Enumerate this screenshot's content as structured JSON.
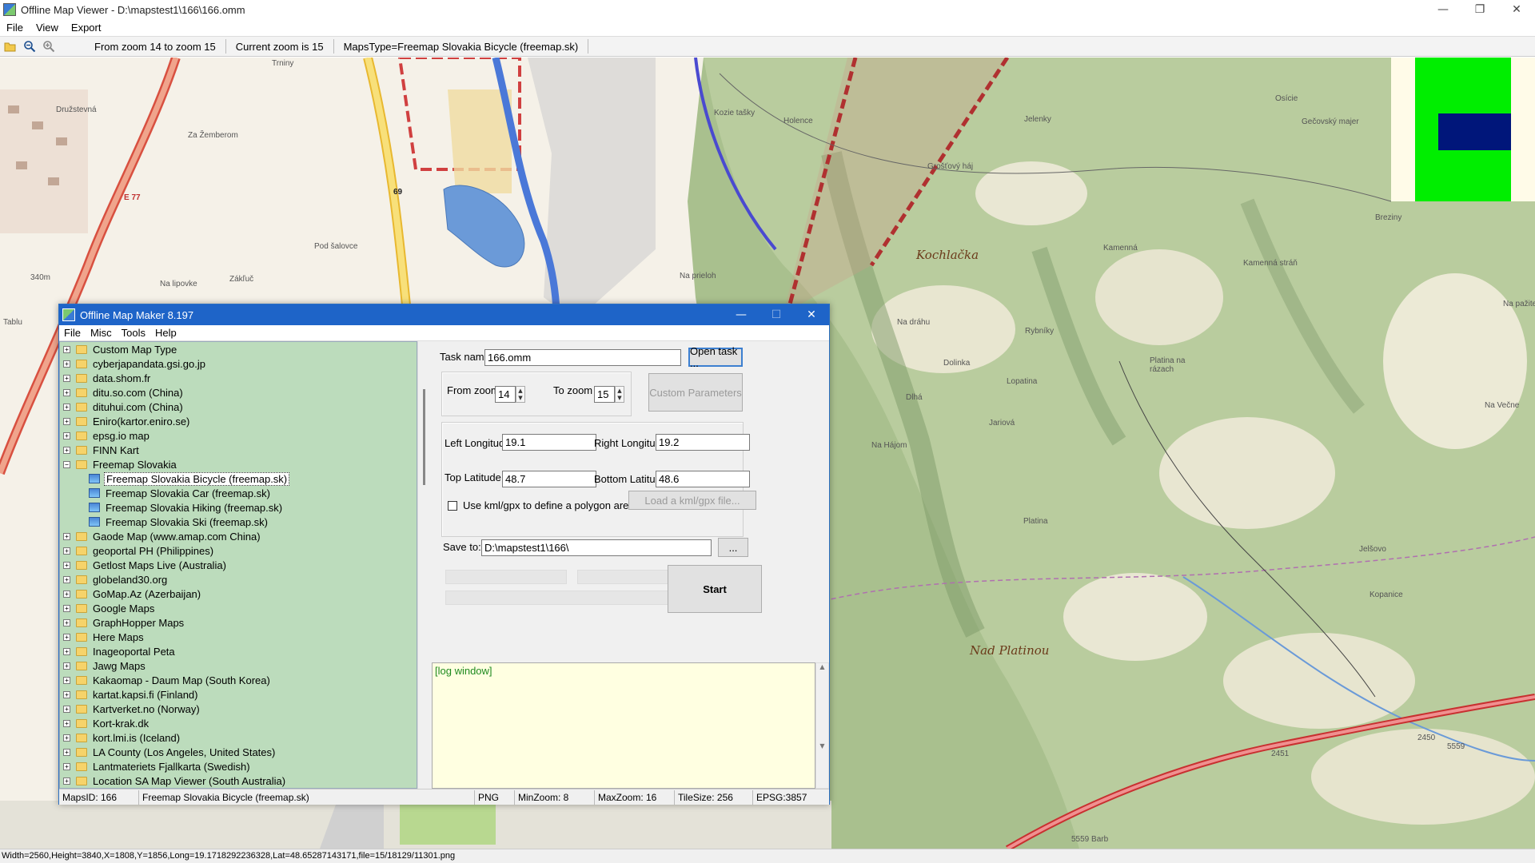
{
  "window": {
    "title": "Offline Map Viewer - D:\\mapstest1\\166\\166.omm",
    "controls": [
      "—",
      "❐",
      "✕"
    ]
  },
  "menu": [
    "File",
    "View",
    "Export"
  ],
  "toolbar": {
    "zoom_range": "From zoom 14 to zoom 15",
    "current_zoom": "Current zoom is 15",
    "maps_type": "MapsType=Freemap Slovakia Bicycle (freemap.sk)"
  },
  "map": {
    "labels": {
      "trniny": "Trniny",
      "druzstevna": "Družstevná",
      "za_zemberom": "Za Žemberom",
      "pod_salovce": "Pod šalovce",
      "na_lipovke": "Na lipovke",
      "zakluc": "Zákľuč",
      "elev_340": "340m",
      "tablu": "Tablu",
      "kozie_tasky": "Kozie tašky",
      "holence": "Holence",
      "jelenky": "Jelenky",
      "osicie": "Osície",
      "gecovsky_majer": "Gečovský majer",
      "grostovy_haj": "Grošťový háj",
      "breziny": "Breziny",
      "kamenna": "Kamenná",
      "kamenna_stran": "Kamenná stráň",
      "na_prieloh": "Na prieloh",
      "na_drahu": "Na dráhu",
      "rybniky": "Rybníky",
      "na_pazite": "Na pažite",
      "dolinka": "Dolinka",
      "platina_na_razach": "Platina na rázach",
      "lopatina": "Lopatina",
      "dlha": "Dlhá",
      "jariova": "Jariová",
      "na_hajom": "Na Hájom",
      "na_vecne": "Na Večne",
      "platina": "Platina",
      "jelsovo": "Jelšovo",
      "kopanice": "Kopanice",
      "road_2450": "2450",
      "road_5559": "5559",
      "road_5559_barb": "5559 Barb",
      "road_2451": "2451",
      "road_69": "69",
      "road_e77": "E 77"
    },
    "peaks": {
      "kochlacka": "Kochlačka",
      "nad_platinou": "Nad Platinou"
    },
    "minimap_colors": {
      "background": "#fffbe8",
      "coverage": "#00ee00",
      "viewport": "#00167a"
    }
  },
  "statusbar": {
    "text": "Width=2560,Height=3840,X=1808,Y=1856,Long=19.1718292236328,Lat=48.65287143171,file=15/18129/11301.png"
  },
  "dialog": {
    "title": "Offline Map Maker 8.197",
    "controls": [
      "—",
      "☐",
      "✕"
    ],
    "menu": [
      "File",
      "Misc",
      "Tools",
      "Help"
    ],
    "tree": [
      {
        "label": "Custom Map Type",
        "type": "folder"
      },
      {
        "label": "cyberjapandata.gsi.go.jp",
        "type": "folder"
      },
      {
        "label": "data.shom.fr",
        "type": "folder"
      },
      {
        "label": "ditu.so.com (China)",
        "type": "folder"
      },
      {
        "label": "dituhui.com (China)",
        "type": "folder"
      },
      {
        "label": "Eniro(kartor.eniro.se)",
        "type": "folder"
      },
      {
        "label": "epsg.io map",
        "type": "folder"
      },
      {
        "label": "FINN Kart",
        "type": "folder"
      },
      {
        "label": "Freemap Slovakia",
        "type": "folder-open"
      },
      {
        "label": "Freemap Slovakia Bicycle (freemap.sk)",
        "type": "leaf",
        "selected": true
      },
      {
        "label": "Freemap Slovakia Car (freemap.sk)",
        "type": "leaf"
      },
      {
        "label": "Freemap Slovakia Hiking (freemap.sk)",
        "type": "leaf"
      },
      {
        "label": "Freemap Slovakia Ski (freemap.sk)",
        "type": "leaf"
      },
      {
        "label": "Gaode Map (www.amap.com China)",
        "type": "folder"
      },
      {
        "label": "geoportal PH (Philippines)",
        "type": "folder"
      },
      {
        "label": "Getlost Maps Live (Australia)",
        "type": "folder"
      },
      {
        "label": "globeland30.org",
        "type": "folder"
      },
      {
        "label": "GoMap.Az (Azerbaijan)",
        "type": "folder"
      },
      {
        "label": "Google Maps",
        "type": "folder"
      },
      {
        "label": "GraphHopper Maps",
        "type": "folder"
      },
      {
        "label": "Here Maps",
        "type": "folder"
      },
      {
        "label": "Inageoportal Peta",
        "type": "folder"
      },
      {
        "label": "Jawg Maps",
        "type": "folder"
      },
      {
        "label": "Kakaomap - Daum Map (South Korea)",
        "type": "folder"
      },
      {
        "label": "kartat.kapsi.fi (Finland)",
        "type": "folder"
      },
      {
        "label": "Kartverket.no (Norway)",
        "type": "folder"
      },
      {
        "label": "Kort-krak.dk",
        "type": "folder"
      },
      {
        "label": "kort.lmi.is (Iceland)",
        "type": "folder"
      },
      {
        "label": "LA County (Los Angeles, United States)",
        "type": "folder"
      },
      {
        "label": "Lantmateriets Fjallkarta (Swedish)",
        "type": "folder"
      },
      {
        "label": "Location SA Map Viewer (South Australia)",
        "type": "folder"
      }
    ],
    "task": {
      "name_label": "Task name",
      "name_value": "166.omm",
      "open_button": "Open task ..."
    },
    "zoom": {
      "from_label": "From zoom",
      "from_value": "14",
      "to_label": "To zoom",
      "to_value": "15",
      "custom_button": "Custom Parameters"
    },
    "bounds": {
      "left_lon_label": "Left Longitude",
      "left_lon": "19.1",
      "right_lon_label": "Right Longitude",
      "right_lon": "19.2",
      "top_lat_label": "Top Latitude",
      "top_lat": "48.7",
      "bottom_lat_label": "Bottom Latitude",
      "bottom_lat": "48.6",
      "kml_checkbox_label": "Use kml/gpx to define a polygon area",
      "kml_checked": false,
      "kml_button": "Load a kml/gpx file..."
    },
    "save": {
      "label": "Save to:",
      "path": "D:\\mapstest1\\166\\",
      "browse_button": "..."
    },
    "start_button": "Start",
    "log": "[log window]",
    "status": {
      "maps_id": "MapsID: 166",
      "maps_name": "Freemap Slovakia Bicycle (freemap.sk)",
      "format": "PNG",
      "min_zoom": "MinZoom: 8",
      "max_zoom": "MaxZoom: 16",
      "tile_size": "TileSize: 256",
      "epsg": "EPSG:3857"
    }
  }
}
